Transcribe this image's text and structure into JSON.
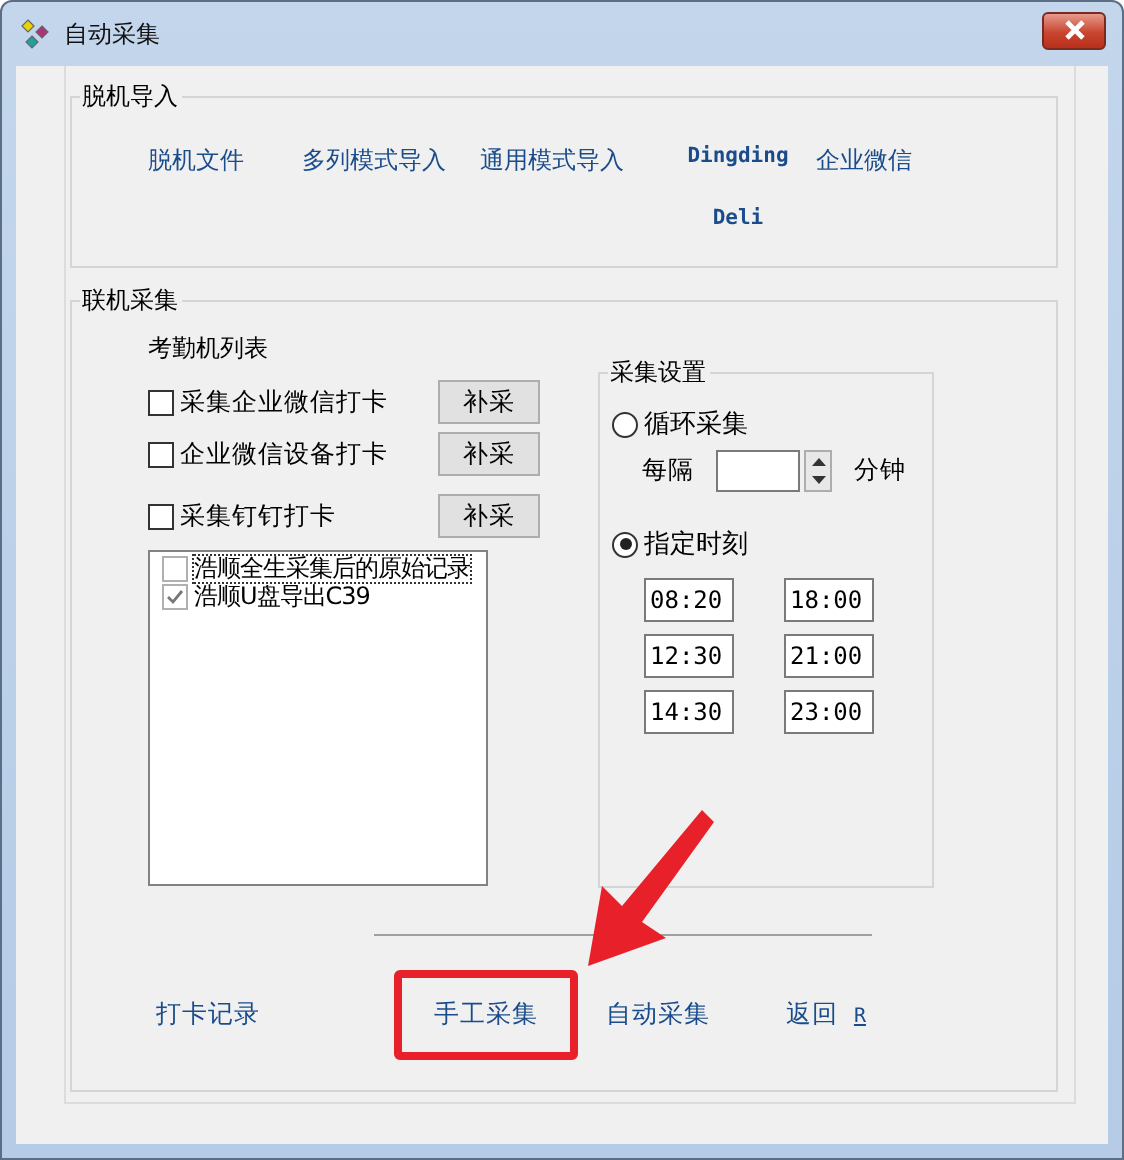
{
  "window": {
    "title": "自动采集"
  },
  "offline_import": {
    "title": "脱机导入",
    "links": [
      {
        "label": "脱机文件",
        "kind": "plain"
      },
      {
        "label": "多列模式导入",
        "kind": "plain"
      },
      {
        "label": "通用模式导入",
        "kind": "plain"
      },
      {
        "label": "Dingding",
        "kind": "mono"
      },
      {
        "label": "企业微信",
        "kind": "plain"
      },
      {
        "label": "Deli",
        "kind": "mono"
      }
    ]
  },
  "online_collect": {
    "title": "联机采集",
    "device_list_label": "考勤机列表",
    "options": [
      {
        "label": "采集企业微信打卡",
        "checked": false,
        "button": "补采"
      },
      {
        "label": "企业微信设备打卡",
        "checked": false,
        "button": "补采"
      },
      {
        "label": "采集钉钉打卡",
        "checked": false,
        "button": "补采"
      }
    ],
    "devices": [
      {
        "label": "浩顺全生采集后的原始记录",
        "checked": false,
        "focused": true
      },
      {
        "label": "浩顺U盘导出C39",
        "checked": true,
        "focused": false
      }
    ],
    "settings": {
      "title": "采集设置",
      "modes": [
        {
          "label": "循环采集",
          "selected": false
        },
        {
          "label": "指定时刻",
          "selected": true
        }
      ],
      "interval_label": "每隔",
      "interval_unit": "分钟",
      "times": [
        "08:20",
        "18:00",
        "12:30",
        "21:00",
        "14:30",
        "23:00"
      ]
    }
  },
  "bottom_links": [
    {
      "label": "打卡记录",
      "highlighted": false
    },
    {
      "label": "手工采集",
      "highlighted": true
    },
    {
      "label": "自动采集",
      "highlighted": false
    },
    {
      "label": "返回",
      "accelerator": "R",
      "highlighted": false
    }
  ]
}
